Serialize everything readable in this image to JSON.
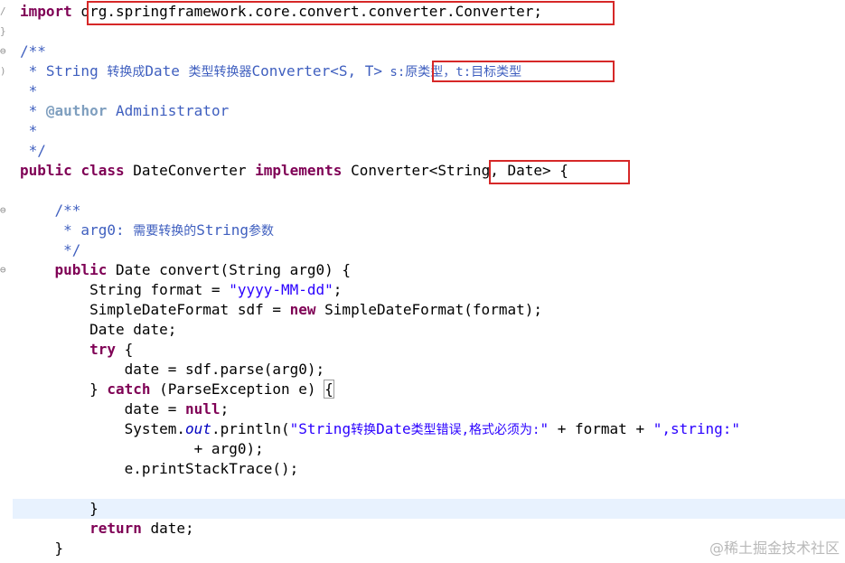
{
  "gutter_labels": [
    "/",
    "}",
    "⊖",
    ")",
    "",
    "",
    "",
    "",
    "",
    "⊖",
    "",
    "",
    "⊖",
    "",
    "",
    "",
    "",
    "",
    "",
    "",
    "",
    "",
    "",
    "",
    "",
    "",
    "",
    ""
  ],
  "code": {
    "l1": {
      "kw": "import",
      "pkg": "org.springframework.core.convert.converter.Converter;"
    },
    "l3": "/**",
    "l4": {
      "a": " * String ",
      "b": "转换成",
      "c": "Date ",
      "d": "类型转换器",
      "e": "Converter<S, T>",
      "f": " s:",
      "g": "原类型",
      "h": "，t:",
      "i": "目标类型"
    },
    "l5": " *",
    "l6": {
      "a": " * ",
      "tag": "@author",
      "b": " Administrator"
    },
    "l7": " *",
    "l8": " */",
    "l9": {
      "kw1": "public",
      "sp1": " ",
      "kw2": "class",
      "a": " DateConverter ",
      "kw3": "implements",
      "b": " Converter",
      "c": "<String, Date>",
      "d": " {"
    },
    "l11": "    /**",
    "l12": {
      "a": "     * arg0: ",
      "b": "需要转换的",
      "c": "String",
      "d": "参数"
    },
    "l13": "     */",
    "l14": {
      "ind": "    ",
      "kw": "public",
      "a": " Date convert(String arg0) {"
    },
    "l15": {
      "a": "        String format = ",
      "str": "\"yyyy-MM-dd\"",
      "b": ";"
    },
    "l16": {
      "a": "        SimpleDateFormat sdf = ",
      "kw": "new",
      "b": " SimpleDateFormat(format);"
    },
    "l17": "        Date date;",
    "l18": {
      "ind": "        ",
      "kw": "try",
      "a": " {"
    },
    "l19": "            date = sdf.parse(arg0);",
    "l20": {
      "a": "        } ",
      "kw": "catch",
      "b": " (ParseException e) ",
      "c": "{"
    },
    "l21": {
      "a": "            date = ",
      "kw": "null",
      "b": ";"
    },
    "l22": {
      "a": "            System.",
      "fld": "out",
      "b": ".println(",
      "s1": "\"String",
      "s2": "转换",
      "s3": "Date",
      "s4": "类型错误,格式必须为:",
      "s5": "\"",
      "c": " + format + ",
      "s6": "\",string:\""
    },
    "l23": "                    + arg0);",
    "l24": "            e.printStackTrace();",
    "l26": "        }",
    "l27": {
      "ind": "        ",
      "kw": "return",
      "a": " date;"
    },
    "l28": "    }"
  },
  "watermark": "@稀土掘金技术社区"
}
